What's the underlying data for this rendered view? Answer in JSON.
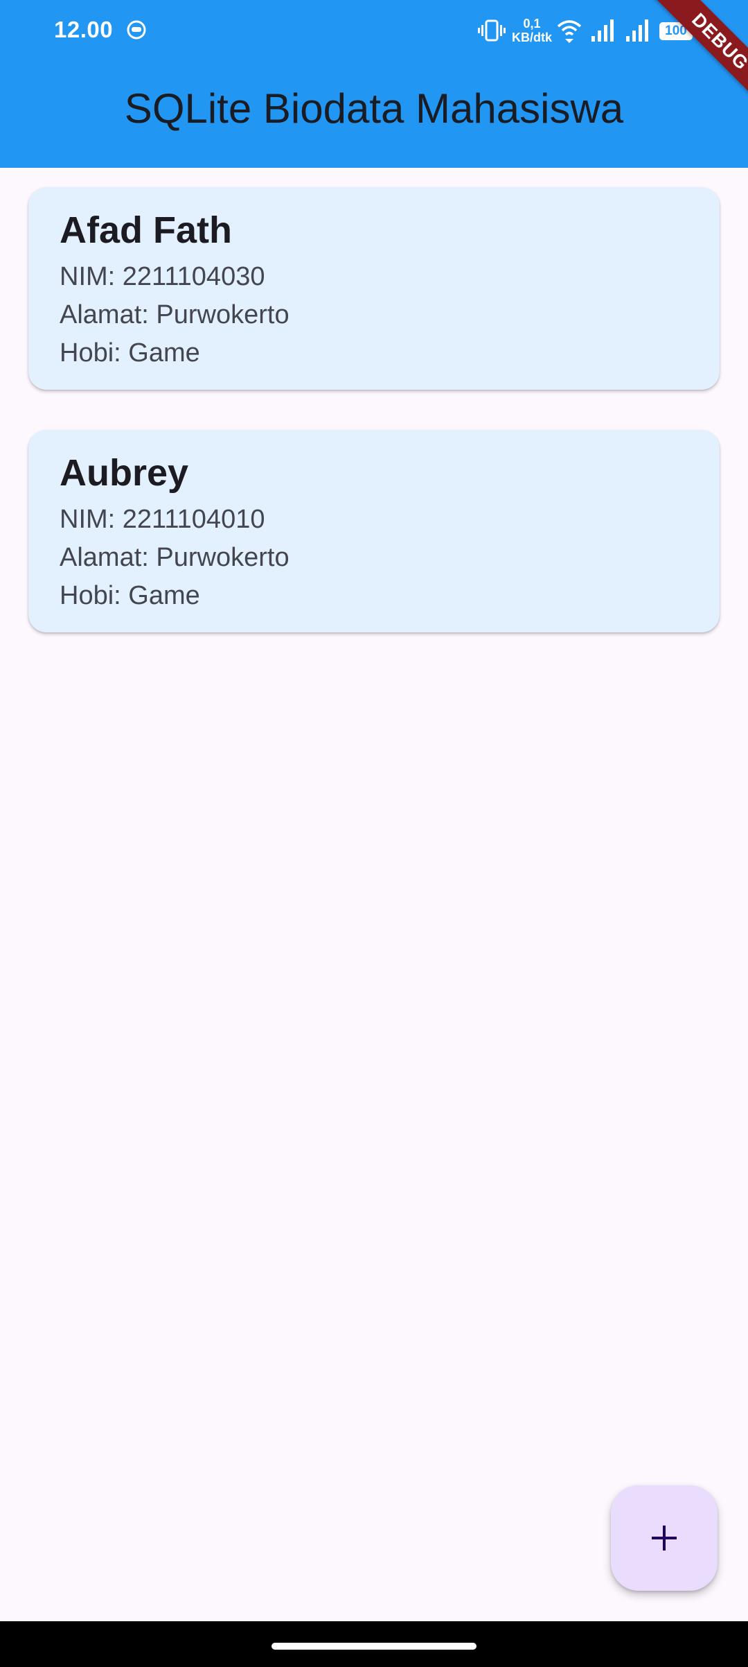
{
  "status_bar": {
    "time": "12.00",
    "net_speed_value": "0,1",
    "net_speed_unit": "KB/dtk",
    "battery": "100",
    "icons": [
      "notification-icon",
      "vibrate-icon",
      "wifi-icon",
      "signal-icon",
      "signal-icon"
    ]
  },
  "debug_banner": "DEBUG",
  "app_bar": {
    "title": "SQLite Biodata Mahasiswa",
    "color": "#2196f3"
  },
  "students": [
    {
      "name": "Afad Fath",
      "nim": "NIM: 2211104030",
      "alamat": "Alamat: Purwokerto",
      "hobi": "Hobi: Game"
    },
    {
      "name": "Aubrey",
      "nim": "NIM: 2211104010",
      "alamat": "Alamat: Purwokerto",
      "hobi": "Hobi: Game"
    }
  ],
  "fab": {
    "icon": "plus-icon",
    "color": "#eadcfd"
  }
}
